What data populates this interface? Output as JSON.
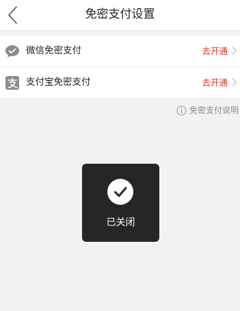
{
  "header": {
    "title": "免密支付设置",
    "back_icon": "chevron-left-icon"
  },
  "payment_options": [
    {
      "icon": "wechat-icon",
      "label": "微信免密支付",
      "action": "去开通"
    },
    {
      "icon": "alipay-icon",
      "label": "支付宝免密支付",
      "action": "去开通"
    }
  ],
  "help": {
    "icon": "info-icon",
    "text": "免密支付说明"
  },
  "toast": {
    "icon": "check-circle-icon",
    "message": "已关闭"
  },
  "colors": {
    "action": "#d8362a",
    "background": "#f2f2f2",
    "toast": "#262626"
  }
}
